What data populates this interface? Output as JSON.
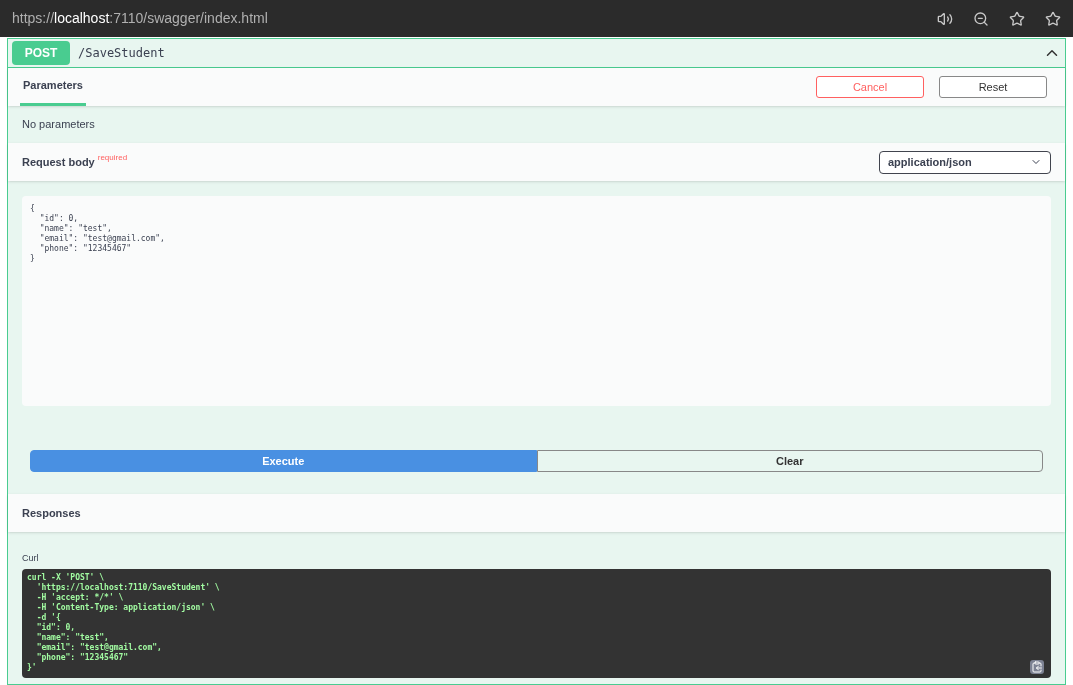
{
  "browser": {
    "url_scheme": "https://",
    "url_host": "localhost",
    "url_rest": ":7110/swagger/index.html"
  },
  "operation": {
    "method": "POST",
    "path": "/SaveStudent",
    "expanded": true
  },
  "tabs": [
    {
      "label": "Parameters",
      "selected": true
    }
  ],
  "actions": [
    {
      "label": "Cancel",
      "kind": "cancel"
    },
    {
      "label": "Reset",
      "kind": "reset"
    }
  ],
  "parameters_message": "No parameters",
  "request_body": {
    "title": "Request body",
    "required_label": "required",
    "content_type": "application/json",
    "value": "{\n  \"id\": 0,\n  \"name\": \"test\",\n  \"email\": \"test@gmail.com\",\n  \"phone\": \"12345467\"\n}"
  },
  "execute": [
    {
      "label": "Execute",
      "kind": "primary"
    },
    {
      "label": "Clear",
      "kind": "secondary"
    }
  ],
  "responses": {
    "title": "Responses",
    "curl_label": "Curl",
    "curl": "curl -X 'POST' \\\n  'https://localhost:7110/SaveStudent' \\\n  -H 'accept: */*' \\\n  -H 'Content-Type: application/json' \\\n  -d '{\n  \"id\": 0,\n  \"name\": \"test\",\n  \"email\": \"test@gmail.com\",\n  \"phone\": \"12345467\"\n}'"
  }
}
